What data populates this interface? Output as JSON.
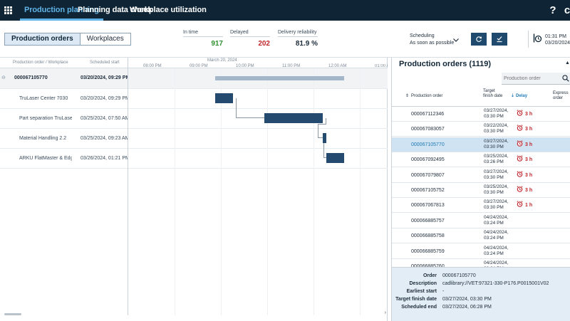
{
  "nav": {
    "tabs": [
      {
        "label": "Production planning",
        "active": true
      },
      {
        "label": "Planning data check",
        "active": false
      },
      {
        "label": "Workplace utilization",
        "active": false
      }
    ],
    "help_symbol": "?",
    "user_symbol": "c"
  },
  "toolbar": {
    "view_toggle": {
      "production_orders": "Production orders",
      "workplaces": "Workplaces"
    },
    "kpis": [
      {
        "label": "In time",
        "value": "917"
      },
      {
        "label": "Delayed",
        "value": "202"
      },
      {
        "label": "Delivery reliability",
        "value": "81.9 %"
      }
    ],
    "scheduling": {
      "label": "Scheduling",
      "value": "As soon as possible"
    },
    "clock": {
      "time": "01:31 PM",
      "date": "03/20/2024"
    }
  },
  "gantt": {
    "headers": {
      "order_workplace": "Production order / Workplace",
      "scheduled_start": "Scheduled start"
    },
    "date_header": "March 20, 2024",
    "hours": [
      "08:00 PM",
      "09:00 PM",
      "10:00 PM",
      "11:00 PM",
      "12:00 AM",
      "01:00 A"
    ],
    "rows": [
      {
        "name": "000067105770",
        "start": "03/20/2024, 09:29 PM",
        "parent": true
      },
      {
        "name": "TruLaser Center 7030",
        "start": "03/20/2024, 09:29 PM"
      },
      {
        "name": "Part separation TruLaser Center",
        "start": "03/25/2024, 07:50 AM"
      },
      {
        "name": "Material Handling 2.2",
        "start": "03/25/2024, 09:23 AM"
      },
      {
        "name": "ARKU FlatMaster & EdgeBreaker",
        "start": "03/26/2024, 01:21 PM"
      }
    ]
  },
  "panel": {
    "title": "Production orders (1119)",
    "search_placeholder": "Production order",
    "columns": {
      "order": "Production order",
      "finish": "Target finish date",
      "delay": "Delay",
      "express": "Express order"
    },
    "rows": [
      {
        "order": "000067112346",
        "finish_date": "03/27/2024,",
        "finish_time": "03:30 PM",
        "delay": "3 h",
        "alarm": true,
        "selected": false
      },
      {
        "order": "000067083057",
        "finish_date": "03/22/2024,",
        "finish_time": "03:30 PM",
        "delay": "3 h",
        "alarm": true,
        "selected": false
      },
      {
        "order": "000067105770",
        "finish_date": "03/27/2024,",
        "finish_time": "03:30 PM",
        "delay": "3 h",
        "alarm": true,
        "selected": true
      },
      {
        "order": "000067092495",
        "finish_date": "03/25/2024,",
        "finish_time": "03:26 PM",
        "delay": "3 h",
        "alarm": true,
        "selected": false
      },
      {
        "order": "000067079807",
        "finish_date": "03/27/2024,",
        "finish_time": "03:30 PM",
        "delay": "3 h",
        "alarm": true,
        "selected": false
      },
      {
        "order": "000067105752",
        "finish_date": "03/25/2024,",
        "finish_time": "03:30 PM",
        "delay": "3 h",
        "alarm": true,
        "selected": false
      },
      {
        "order": "000067067813",
        "finish_date": "03/27/2024,",
        "finish_time": "03:30 PM",
        "delay": "1 h",
        "alarm": true,
        "selected": false
      },
      {
        "order": "000066885757",
        "finish_date": "04/24/2024,",
        "finish_time": "03:24 PM",
        "delay": "",
        "alarm": false,
        "selected": false
      },
      {
        "order": "000066885758",
        "finish_date": "04/24/2024,",
        "finish_time": "03:24 PM",
        "delay": "",
        "alarm": false,
        "selected": false
      },
      {
        "order": "000066885759",
        "finish_date": "04/24/2024,",
        "finish_time": "03:24 PM",
        "delay": "",
        "alarm": false,
        "selected": false
      },
      {
        "order": "000066885760",
        "finish_date": "04/24/2024,",
        "finish_time": "03:24 PM",
        "delay": "",
        "alarm": false,
        "selected": false
      }
    ],
    "detail": [
      {
        "key": "Order",
        "value": "000067105770"
      },
      {
        "key": "Description",
        "value": "cadlibrary://VET:97321-330-P176.P0015001V02"
      },
      {
        "key": "Earliest start",
        "value": "-"
      },
      {
        "key": "Target finish date",
        "value": "03/27/2024, 03:30 PM"
      },
      {
        "key": "Scheduled end",
        "value": "03/27/2024, 06:28 PM"
      }
    ]
  },
  "colors": {
    "nav_bg": "#0f2536",
    "accent": "#5fb3e6",
    "bar": "#244a70",
    "green": "#2f8f2f",
    "red": "#c0272d"
  }
}
